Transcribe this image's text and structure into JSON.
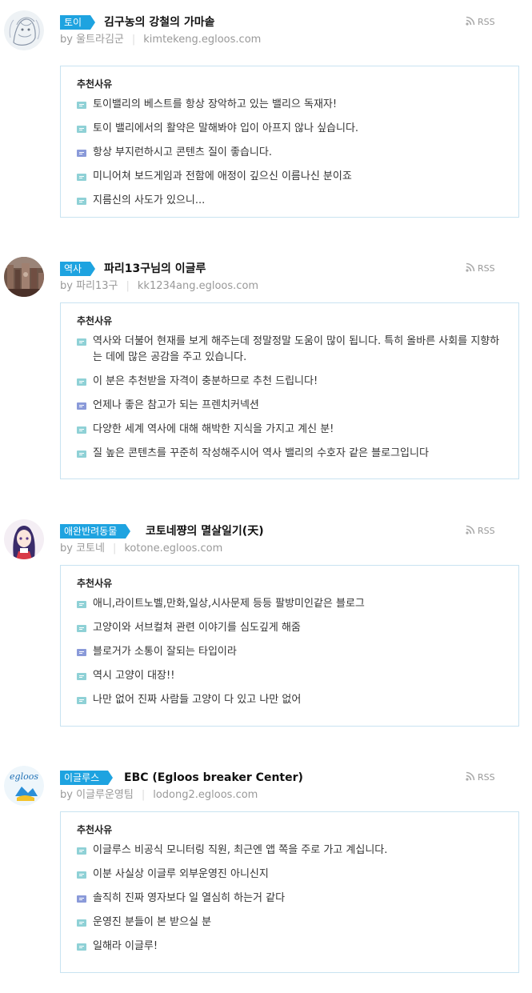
{
  "rss_label": "RSS",
  "reason_heading": "추천사유",
  "colors": {
    "accent": "#1ea3e0",
    "box_border": "#c9e3f1",
    "bubble": "#8fd1d6",
    "bubble_alt": "#8a9ad9"
  },
  "entries": [
    {
      "category": "토이",
      "title": "김구농의 강철의 가마솥",
      "author": "by 울트라김군",
      "url": "kimtekeng.egloos.com",
      "avatar_icon": "sketch-avatar-icon",
      "reasons": [
        "토이밸리의 베스트를 항상 장악하고 있는 밸리으 독재자!",
        "토이 밸리에서의 활약은 말해봐야 입이 아프지 않나 싶습니다.",
        "항상 부지런하시고 콘텐츠 질이 좋습니다.",
        "미니어쳐 보드게임과 전함에 애정이 깊으신 이름나신 분이죠",
        "지름신의 사도가 있으니..."
      ]
    },
    {
      "category": "역사",
      "title": "파리13구님의 이글루",
      "author": "by 파리13구",
      "url": "kk1234ang.egloos.com",
      "avatar_icon": "city-photo-avatar-icon",
      "reasons": [
        "역사와 더불어 현재를 보게 해주는데 정말정말 도움이 많이 됩니다. 특히 올바른 사회를 지향하는 데에 많은 공감을 주고 있습니다.",
        "이 분은 추천받을 자격이 충분하므로 추천 드립니다!",
        "언제나 좋은 참고가 되는 프렌치커넥션",
        "다양한 세계 역사에 대해 해박한 지식을 가지고 계신 분!",
        "질 높은 콘텐츠를 꾸준히 작성해주시어 역사 밸리의 수호자 같은 블로그입니다"
      ]
    },
    {
      "category": "애완반려동물",
      "title": "코토네쨩의 멸살일기(天)",
      "author": "by 코토네",
      "url": "kotone.egloos.com",
      "avatar_icon": "anime-girl-avatar-icon",
      "reasons": [
        "애니,라이트노벨,만화,일상,시사문제 등등 팔방미인같은 블로그",
        "고양이와 서브컬쳐 관련 이야기를 심도깊게 해줌",
        "블로거가 소통이 잘되는 타입이라",
        "역시 고양이 대장!!",
        "나만 없어 진짜 사람들 고양이 다 있고 나만 없어"
      ]
    },
    {
      "category": "이글루스",
      "title": "EBC (Egloos breaker Center)",
      "author": "by 이글루운영팀",
      "url": "lodong2.egloos.com",
      "avatar_icon": "egloos-logo-avatar-icon",
      "avatar_text": "egloos",
      "reasons": [
        "이글루스 비공식 모니터링 직원, 최근엔 앱 쪽을 주로 가고 계십니다.",
        "이분 사실상 이글루 외부운영진 아니신지",
        "솔직히 진짜 영자보다 일 열심히 하는거 같다",
        "운영진 분들이 본 받으실 분",
        "일해라 이글루!"
      ]
    }
  ]
}
